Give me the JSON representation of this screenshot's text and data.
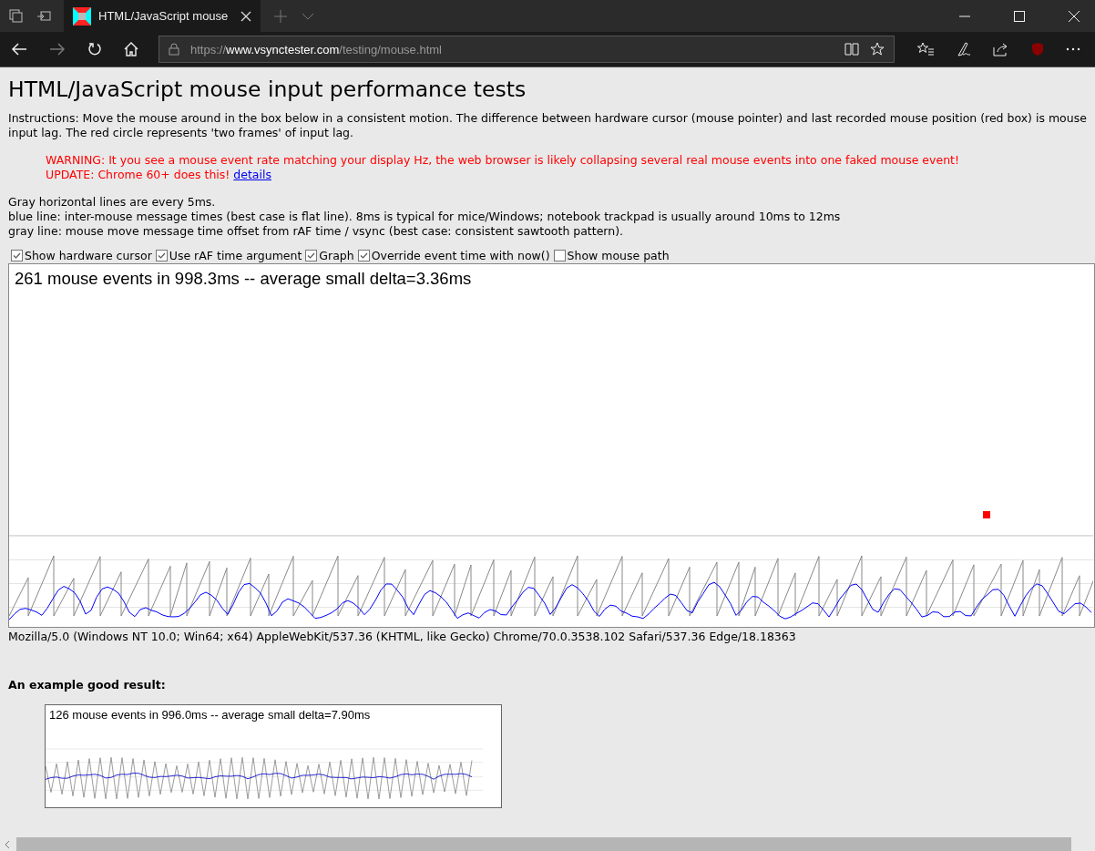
{
  "browser": {
    "tab": {
      "title": "HTML/JavaScript mouse",
      "selected": true
    },
    "address": {
      "scheme": "https://",
      "host": "www.vsynctester.com",
      "path": "/testing/mouse.html"
    }
  },
  "page": {
    "title": "HTML/JavaScript mouse input performance tests",
    "instructions": "Instructions: Move the mouse around in the box below in a consistent motion. The difference between hardware cursor (mouse pointer) and last recorded mouse position (red box) is mouse input lag. The red circle represents 'two frames' of input lag.",
    "warning": "WARNING: It you see a mouse event rate matching your display Hz, the web browser is likely collapsing several real mouse events into one faked mouse event!",
    "update": "UPDATE: Chrome 60+ does this!",
    "update_link": "details",
    "notes": [
      "Gray horizontal lines are every 5ms.",
      "blue line: inter-mouse message times (best case is flat line). 8ms is typical for mice/Windows; notebook trackpad is usually around 10ms to 12ms",
      "gray line: mouse move message time offset from rAF time / vsync (best case: consistent sawtooth pattern)."
    ],
    "options": [
      {
        "label": "Show hardware cursor",
        "checked": true
      },
      {
        "label": "Use rAF time argument",
        "checked": true
      },
      {
        "label": "Graph",
        "checked": true
      },
      {
        "label": "Override event time with now()",
        "checked": true
      },
      {
        "label": "Show mouse path",
        "checked": false
      }
    ],
    "test_box": {
      "summary": "261 mouse events in 998.3ms -- average small delta=3.36ms"
    },
    "user_agent": "Mozilla/5.0 (Windows NT 10.0; Win64; x64) AppleWebKit/537.36 (KHTML, like Gecko) Chrome/70.0.3538.102 Safari/537.36 Edge/18.18363",
    "example_heading": "An example good result:",
    "example_box": {
      "summary": "126 mouse events in 996.0ms -- average small delta=7.90ms"
    }
  }
}
